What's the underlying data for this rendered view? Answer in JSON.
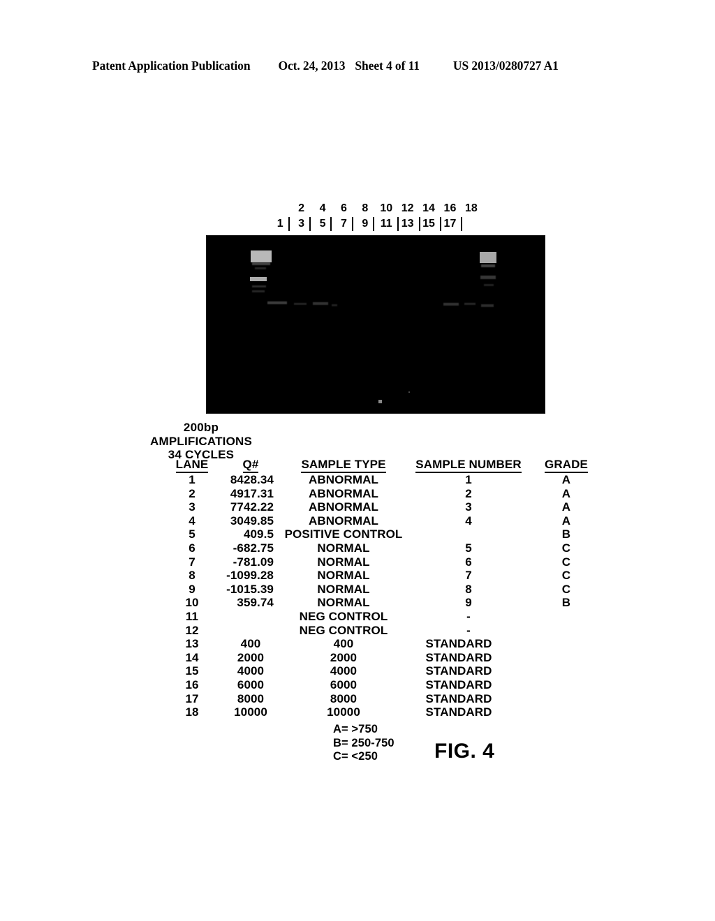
{
  "header": {
    "publication": "Patent Application Publication",
    "date": "Oct. 24, 2013",
    "sheet": "Sheet 4 of 11",
    "patent_number": "US 2013/0280727 A1"
  },
  "gel": {
    "lane_numbers_top": [
      "",
      "2",
      "4",
      "6",
      "8",
      "10",
      "12",
      "14",
      "16",
      "18"
    ],
    "lane_numbers_bottom": [
      "1",
      "3",
      "5",
      "7",
      "9",
      "11",
      "13",
      "15",
      "17",
      ""
    ],
    "description": "electrophoresis gel photograph"
  },
  "title_block": {
    "line1": "200bp",
    "line2": "AMPLIFICATIONS",
    "line3": "34 CYCLES"
  },
  "table": {
    "columns": [
      "LANE",
      "Q#",
      "SAMPLE TYPE",
      "SAMPLE NUMBER",
      "GRADE"
    ],
    "rows": [
      {
        "lane": "1",
        "q": "8428.34",
        "type": "ABNORMAL",
        "number": "1",
        "grade": "A"
      },
      {
        "lane": "2",
        "q": "4917.31",
        "type": "ABNORMAL",
        "number": "2",
        "grade": "A"
      },
      {
        "lane": "3",
        "q": "7742.22",
        "type": "ABNORMAL",
        "number": "3",
        "grade": "A"
      },
      {
        "lane": "4",
        "q": "3049.85",
        "type": "ABNORMAL",
        "number": "4",
        "grade": "A"
      },
      {
        "lane": "5",
        "q": "409.5",
        "type": "POSITIVE CONTROL",
        "number": "",
        "grade": "B"
      },
      {
        "lane": "6",
        "q": "-682.75",
        "type": "NORMAL",
        "number": "5",
        "grade": "C"
      },
      {
        "lane": "7",
        "q": "-781.09",
        "type": "NORMAL",
        "number": "6",
        "grade": "C"
      },
      {
        "lane": "8",
        "q": "-1099.28",
        "type": "NORMAL",
        "number": "7",
        "grade": "C"
      },
      {
        "lane": "9",
        "q": "-1015.39",
        "type": "NORMAL",
        "number": "8",
        "grade": "C"
      },
      {
        "lane": "10",
        "q": "359.74",
        "type": "NORMAL",
        "number": "9",
        "grade": "B"
      },
      {
        "lane": "11",
        "q": "",
        "type": "NEG CONTROL",
        "number": "-",
        "grade": ""
      },
      {
        "lane": "12",
        "q": "",
        "type": "NEG CONTROL",
        "number": "-",
        "grade": ""
      },
      {
        "lane": "13",
        "q": "400",
        "type": "400",
        "number": "STANDARD",
        "grade": ""
      },
      {
        "lane": "14",
        "q": "2000",
        "type": "2000",
        "number": "STANDARD",
        "grade": ""
      },
      {
        "lane": "15",
        "q": "4000",
        "type": "4000",
        "number": "STANDARD",
        "grade": ""
      },
      {
        "lane": "16",
        "q": "6000",
        "type": "6000",
        "number": "STANDARD",
        "grade": ""
      },
      {
        "lane": "17",
        "q": "8000",
        "type": "8000",
        "number": "STANDARD",
        "grade": ""
      },
      {
        "lane": "18",
        "q": "10000",
        "type": "10000",
        "number": "STANDARD",
        "grade": ""
      }
    ]
  },
  "legend": {
    "line1": "A= >750",
    "line2": "B= 250-750",
    "line3": "C= <250"
  },
  "figure": {
    "caption": "FIG. 4"
  }
}
